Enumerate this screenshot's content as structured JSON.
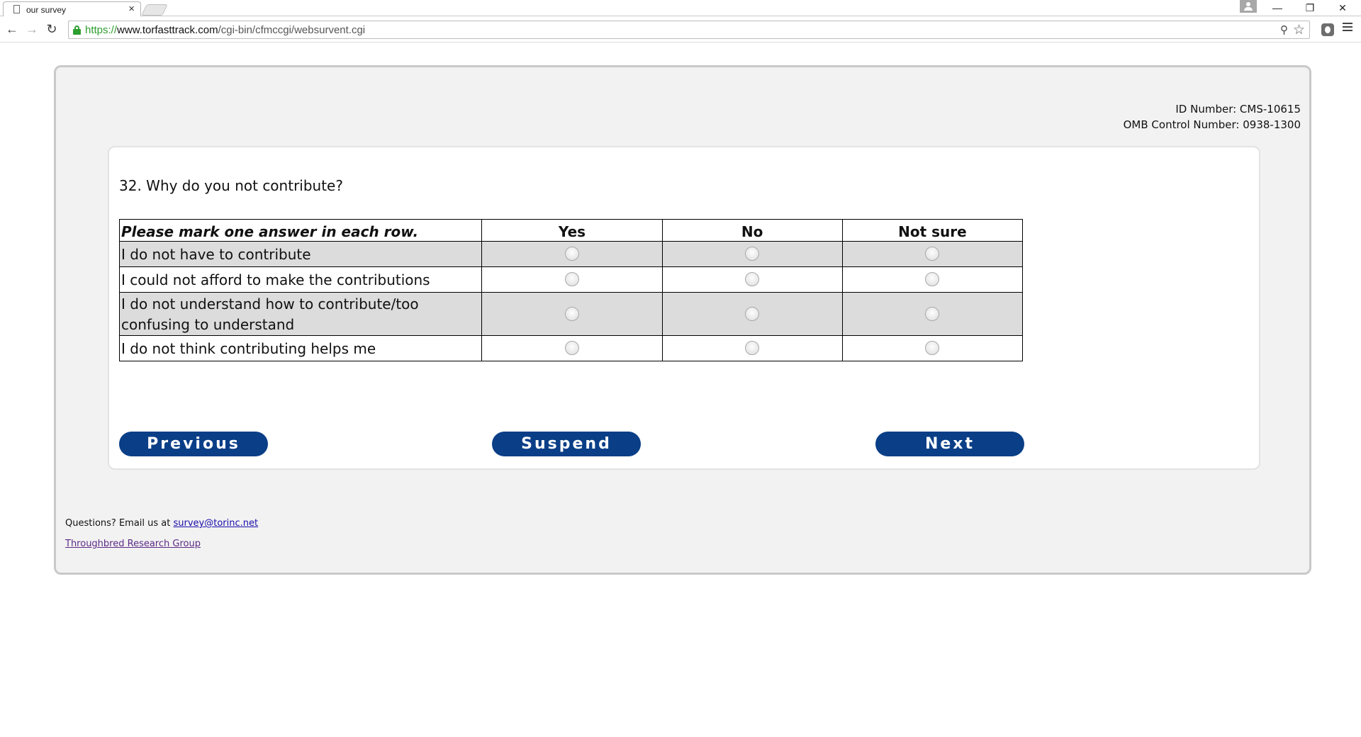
{
  "browser": {
    "tab_title": "our survey",
    "tab_close": "×",
    "url_scheme": "https://",
    "url_host": "www.torfasttrack.com",
    "url_path": "/cgi-bin/cfmccgi/websurvent.cgi",
    "window_controls": {
      "minimize": "—",
      "restore": "❐",
      "close": "✕"
    },
    "nav": {
      "back": "←",
      "forward": "→",
      "reload": "↻"
    },
    "icons": {
      "zoom": "zoom-icon",
      "bookmark": "star-icon",
      "extension": "extension-icon",
      "menu": "menu-icon"
    },
    "zoom_glyph": "⚲",
    "star_glyph": "☆"
  },
  "survey": {
    "id_number": "ID Number: CMS-10615",
    "omb_number": "OMB Control Number: 0938-1300",
    "question": "32. Why do you not contribute?",
    "grid": {
      "instruction": "Please mark one answer in each row.",
      "columns": [
        "Yes",
        "No",
        "Not sure"
      ],
      "rows": [
        {
          "label": "I do not have to contribute",
          "selected": null
        },
        {
          "label": "I could not afford to make the contributions",
          "selected": null
        },
        {
          "label": "I do not understand how to contribute/too confusing to understand",
          "selected": null
        },
        {
          "label": "I do not think contributing helps me",
          "selected": null
        }
      ]
    },
    "buttons": {
      "previous": "Previous",
      "suspend": "Suspend",
      "next": "Next"
    },
    "colors": {
      "button_bg": "#0a3e87",
      "button_text": "#ffffff",
      "row_shade": "#dcdcdc"
    }
  },
  "footer": {
    "questions_prefix": "Questions? Email us at ",
    "email": "survey@torinc.net",
    "org_link": "Throughbred Research Group"
  }
}
